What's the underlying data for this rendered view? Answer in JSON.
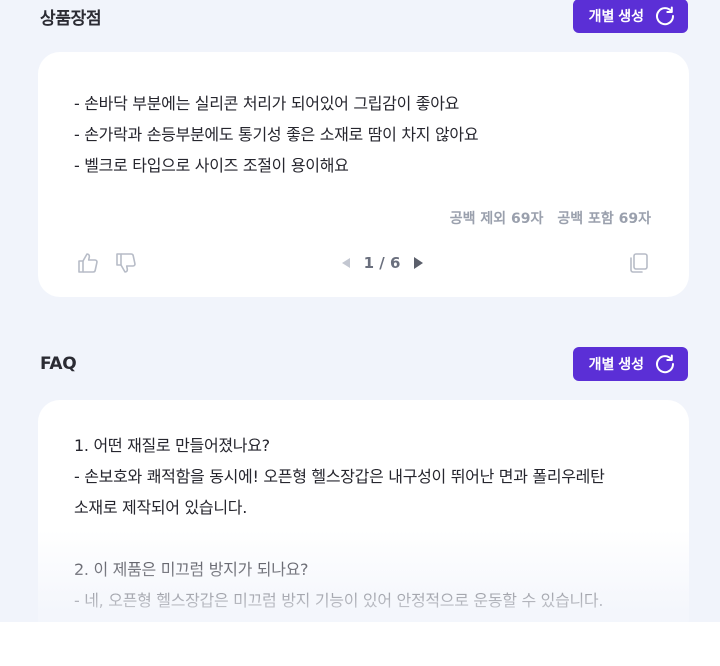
{
  "section1": {
    "title": "상품장점",
    "button_label": "개별 생성",
    "lines": [
      "- 손바닥 부분에는 실리콘 처리가 되어있어 그립감이 좋아요",
      "- 손가락과 손등부분에도 통기성 좋은 소재로 땀이 차지 않아요",
      "- 벨크로 타입으로 사이즈 조절이 용이해요"
    ],
    "char_count_no_space": "공백 제외 69자",
    "char_count_with_space": "공백 포함 69자",
    "pager": "1 / 6"
  },
  "section2": {
    "title": "FAQ",
    "button_label": "개별 생성",
    "lines": [
      "1. 어떤 재질로 만들어졌나요?",
      "- 손보호와 쾌적함을 동시에! 오픈형 헬스장갑은 내구성이 뛰어난 면과 폴리우레탄",
      "소재로 제작되어 있습니다.",
      "2. 이 제품은 미끄럼 방지가 되나요?",
      "- 네, 오픈형 헬스장갑은 미끄럼 방지 기능이 있어 안정적으로 운동할 수 있습니다."
    ]
  },
  "colors": {
    "accent": "#5b2fd6",
    "background": "#f1f4fb",
    "card": "#ffffff"
  },
  "icons": [
    "refresh-icon",
    "thumbs-up-icon",
    "thumbs-down-icon",
    "prev-arrow-icon",
    "next-arrow-icon",
    "copy-icon"
  ]
}
